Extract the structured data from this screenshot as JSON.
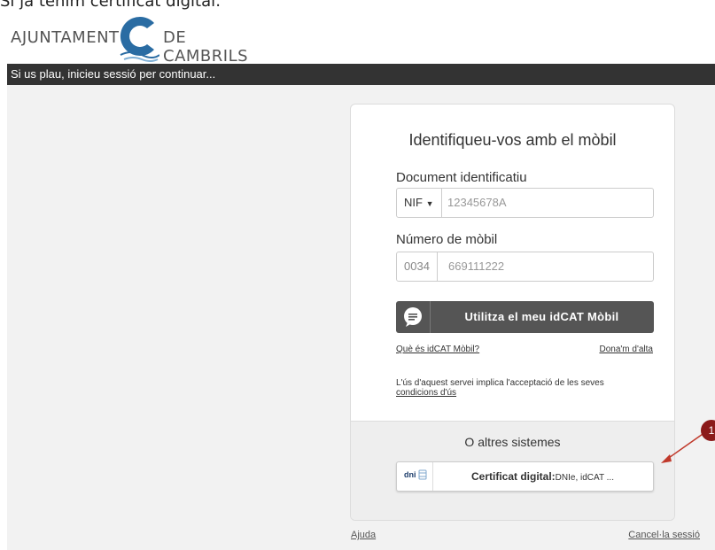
{
  "page": {
    "caption": "Si ja tenim certificat digital:"
  },
  "logo": {
    "left_text": "AJUNTAMENT",
    "right_text": "DE CAMBRILS",
    "accent_color": "#2a6ca3"
  },
  "topbar": {
    "text": "Si us plau, inicieu sessió per continuar..."
  },
  "login_card": {
    "title": "Identifiqueu-vos amb el mòbil",
    "document": {
      "label": "Document identificatiu",
      "type_selected": "NIF",
      "placeholder": "12345678A"
    },
    "mobile": {
      "label": "Número de mòbil",
      "prefix": "0034",
      "placeholder": "669111222"
    },
    "idcat_button": {
      "label": "Utilitza el meu idCAT Mòbil",
      "icon": "chat-bubble-icon"
    },
    "what_is_link": "Què és idCAT Mòbil?",
    "signup_link": "Dona'm d'alta",
    "terms_text": "L'ús d'aquest servei implica l'acceptació de les seves",
    "terms_link": "condicions d'ús"
  },
  "other_systems": {
    "title": "O altres sistemes",
    "cert_button": {
      "icon_text": "dni",
      "label_bold": "Certificat digital:",
      "label_rest": "DNIe, idCAT ..."
    }
  },
  "footer": {
    "help_link": "Ajuda",
    "cancel_link": "Cancel·la sessió"
  },
  "annotation": {
    "badge_number": "1",
    "color": "#8b1a1a"
  }
}
